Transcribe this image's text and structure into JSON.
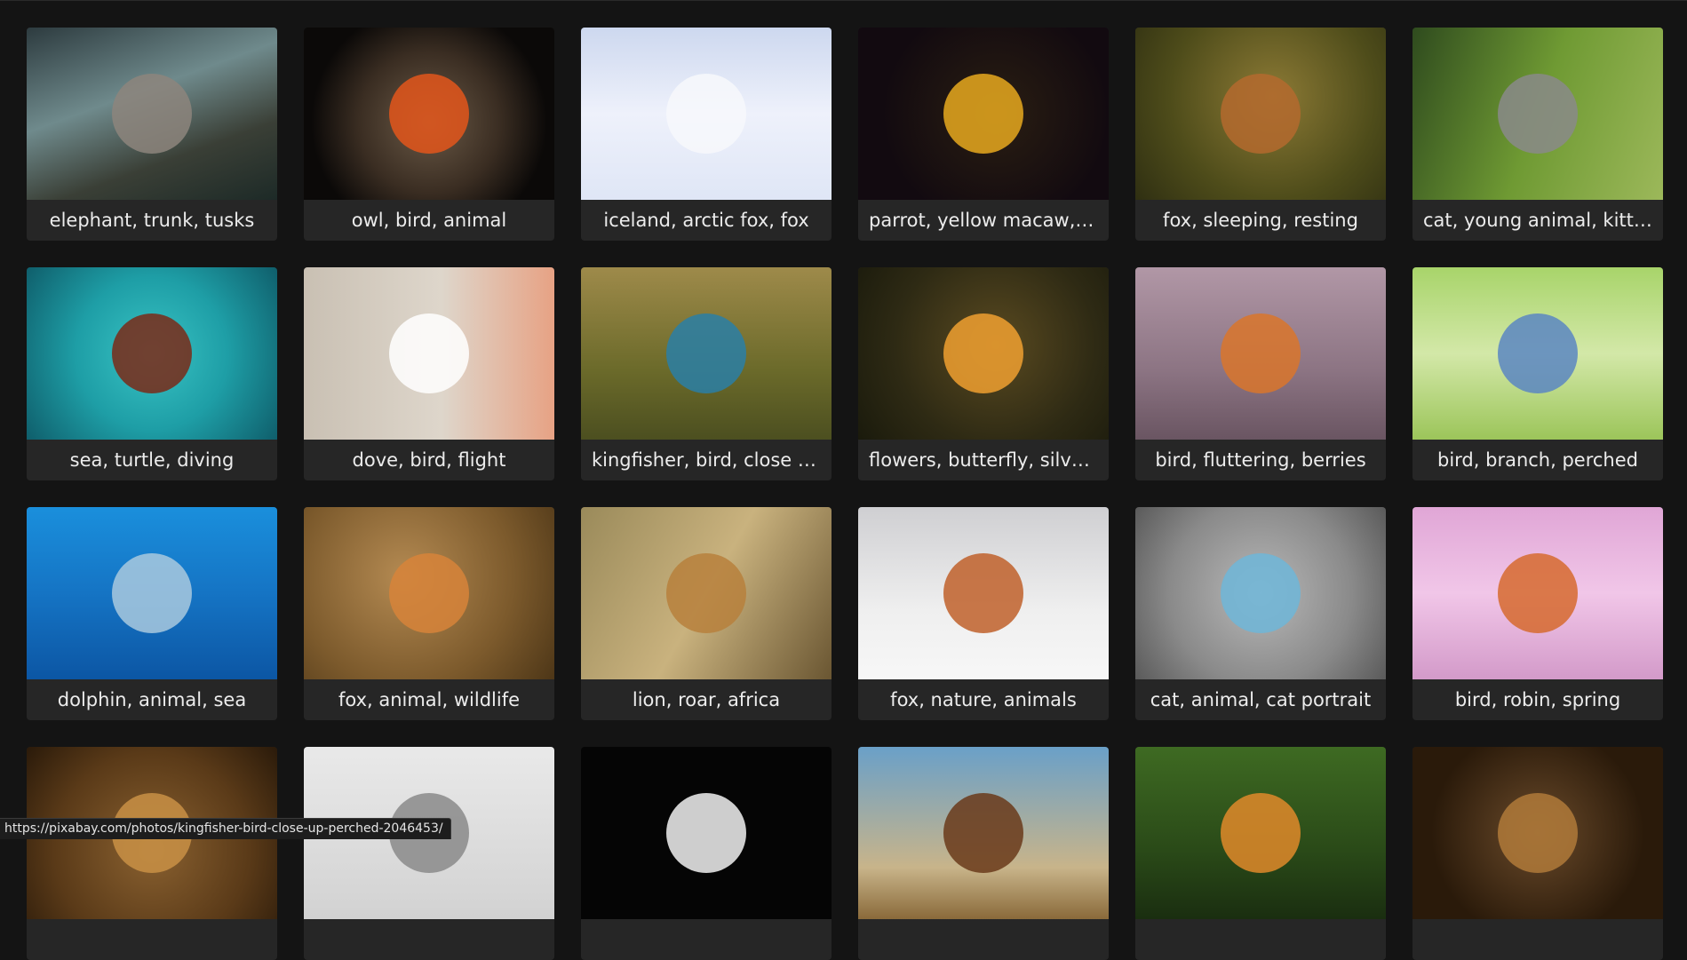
{
  "gallery": {
    "items": [
      {
        "caption": "elephant, trunk, tusks",
        "bg": "linear-gradient(160deg,#2d3b3f 0%,#6f8a8c 40%,#3a3f36 70%,#1d2a27 100%)",
        "accent": "#8d857c"
      },
      {
        "caption": "owl, bird, animal",
        "bg": "radial-gradient(circle at 50% 55%,#6b5a47 0%,#3a2d22 45%,#0b0908 75%)",
        "accent": "#e3561b"
      },
      {
        "caption": "iceland, arctic fox, fox",
        "bg": "linear-gradient(180deg,#cdd8ef 0%,#eef1fb 50%,#dfe6f6 100%)",
        "accent": "#f7f8fb"
      },
      {
        "caption": "parrot, yellow macaw, bird",
        "bg": "radial-gradient(circle at 55% 50%,#2a1e12 0%,#120a10 70%)",
        "accent": "#e7a91e"
      },
      {
        "caption": "fox, sleeping, resting",
        "bg": "radial-gradient(circle at 55% 40%,#8c7a35 0%,#4e4c1a 60%,#2f2f12 100%)",
        "accent": "#b46a2e"
      },
      {
        "caption": "cat, young animal, kitten",
        "bg": "linear-gradient(110deg,#2f4b1e 0%,#6f9a33 50%,#9cb85a 100%)",
        "accent": "#8a8a8a"
      },
      {
        "caption": "sea, turtle, diving",
        "bg": "radial-gradient(circle at 50% 50%,#39c3c4 0%,#1e9ea6 50%,#0f5e6b 100%)",
        "accent": "#7a2a18"
      },
      {
        "caption": "dove, bird, flight",
        "bg": "linear-gradient(90deg,#c9c0b3 0%,#ded6cb 55%,#e7a284 100%)",
        "accent": "#ffffff"
      },
      {
        "caption": "kingfisher, bird, close up",
        "bg": "linear-gradient(180deg,#9e8a4a 0%,#6b6a2a 60%,#4c4f20 100%)",
        "accent": "#2a7fa6"
      },
      {
        "caption": "flowers, butterfly, silver...",
        "bg": "radial-gradient(circle at 55% 45%,#5a4a20 0%,#2e2a14 60%,#1a1a0c 100%)",
        "accent": "#f0a030"
      },
      {
        "caption": "bird, fluttering, berries",
        "bg": "linear-gradient(180deg,#b197a6 0%,#8c7483 60%,#6a5562 100%)",
        "accent": "#d9762c"
      },
      {
        "caption": "bird, branch, perched",
        "bg": "linear-gradient(180deg,#a8d46a 0%,#d3e8a8 50%,#9cc55a 100%)",
        "accent": "#5a86c2"
      },
      {
        "caption": "dolphin, animal, sea",
        "bg": "linear-gradient(180deg,#1a8fdc 0%,#1574c4 50%,#0c56a4 100%)",
        "accent": "#a9c9de"
      },
      {
        "caption": "fox, animal, wildlife",
        "bg": "radial-gradient(circle at 40% 40%,#b48a52 0%,#7c5a2c 60%,#4d3617 100%)",
        "accent": "#d7843a"
      },
      {
        "caption": "lion, roar, africa",
        "bg": "linear-gradient(120deg,#9a8a5a 0%,#c9b27e 50%,#6a5632 100%)",
        "accent": "#b7803c"
      },
      {
        "caption": "fox, nature, animals",
        "bg": "linear-gradient(180deg,#cfcfd2 0%,#efefef 60%,#f7f7f7 100%)",
        "accent": "#c0602a"
      },
      {
        "caption": "cat, animal, cat portrait",
        "bg": "radial-gradient(circle at 50% 50%,#b8b8b8 0%,#8a8a8a 60%,#5a5a5a 100%)",
        "accent": "#6fb6d8"
      },
      {
        "caption": "bird, robin, spring",
        "bg": "linear-gradient(180deg,#e0a6d6 0%,#f1c6e8 50%,#d39ac9 100%)",
        "accent": "#d66a2e"
      },
      {
        "caption": "",
        "bg": "radial-gradient(circle at 50% 60%,#8a6130 0%,#5a3a18 60%,#2a1a0a 100%)",
        "accent": "#c99045"
      },
      {
        "caption": "",
        "bg": "linear-gradient(180deg,#e9e9e9 0%,#d2d2d2 100%)",
        "accent": "#8a8a8a"
      },
      {
        "caption": "",
        "bg": "#050505",
        "accent": "#f2f2f2"
      },
      {
        "caption": "",
        "bg": "linear-gradient(180deg,#6aa0c8 0%,#c8b48a 70%,#8a6a3a 100%)",
        "accent": "#6a3a1a"
      },
      {
        "caption": "",
        "bg": "linear-gradient(180deg,#3e6a22 0%,#2a4a18 60%,#1a2e10 100%)",
        "accent": "#e08a2a"
      },
      {
        "caption": "",
        "bg": "radial-gradient(circle at 50% 50%,#6a4a2a 0%,#2a1a0a 70%)",
        "accent": "#b07a3a"
      }
    ]
  },
  "status": {
    "url": "https://pixabay.com/photos/kingfisher-bird-close-up-perched-2046453/"
  }
}
